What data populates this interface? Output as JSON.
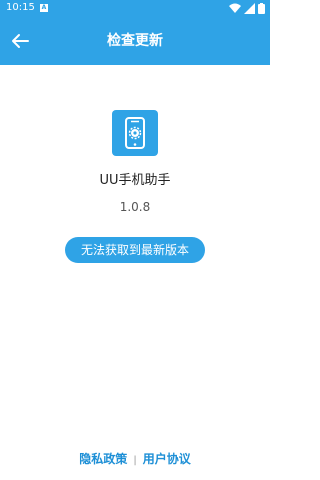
{
  "status_bar": {
    "time": "10:15",
    "notification_letter": "A",
    "icons": [
      "wifi-icon",
      "signal-icon",
      "battery-icon"
    ]
  },
  "app_bar": {
    "title": "检查更新",
    "back_icon": "arrow-left-icon"
  },
  "app": {
    "icon": "phone-gear-icon",
    "name": "UU手机助手",
    "version": "1.0.8"
  },
  "update_button": {
    "label": "无法获取到最新版本"
  },
  "footer": {
    "privacy_label": "隐私政策",
    "separator": "|",
    "agreement_label": "用户协议"
  },
  "colors": {
    "primary": "#2fa3e6",
    "link": "#1d8fd6"
  }
}
